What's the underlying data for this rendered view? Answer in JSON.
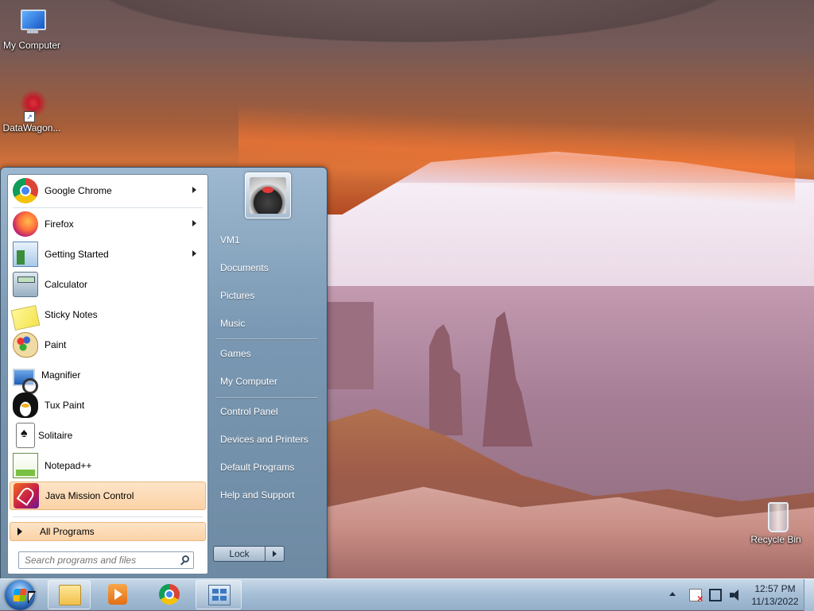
{
  "desktop": {
    "icons": [
      {
        "label": "My Computer",
        "icon": "my-computer-icon"
      },
      {
        "label": "DataWagon...",
        "icon": "datawagon-icon"
      },
      {
        "label": "Recycle Bin",
        "icon": "recycle-bin-icon"
      }
    ]
  },
  "start_menu": {
    "programs": [
      {
        "label": "Google Chrome",
        "icon": "chrome-icon",
        "has_submenu": true
      },
      {
        "label": "Firefox",
        "icon": "firefox-icon",
        "has_submenu": true
      },
      {
        "label": "Getting Started",
        "icon": "getting-started-icon",
        "has_submenu": true
      },
      {
        "label": "Calculator",
        "icon": "calculator-icon",
        "has_submenu": false
      },
      {
        "label": "Sticky Notes",
        "icon": "sticky-notes-icon",
        "has_submenu": false
      },
      {
        "label": "Paint",
        "icon": "paint-icon",
        "has_submenu": false
      },
      {
        "label": "Magnifier",
        "icon": "magnifier-icon",
        "has_submenu": false
      },
      {
        "label": "Tux Paint",
        "icon": "tux-paint-icon",
        "has_submenu": false
      },
      {
        "label": "Solitaire",
        "icon": "solitaire-icon",
        "has_submenu": false
      },
      {
        "label": "Notepad++",
        "icon": "notepad-plus-plus-icon",
        "has_submenu": false
      },
      {
        "label": "Java Mission Control",
        "icon": "java-mission-control-icon",
        "has_submenu": false,
        "highlighted": true
      }
    ],
    "all_programs": "All Programs",
    "search_placeholder": "Search programs and files",
    "right_items": {
      "user": "VM1",
      "documents": "Documents",
      "pictures": "Pictures",
      "music": "Music",
      "games": "Games",
      "my_computer": "My Computer",
      "control_panel": "Control Panel",
      "devices_printers": "Devices and Printers",
      "default_programs": "Default Programs",
      "help_support": "Help and Support"
    },
    "lock_label": "Lock"
  },
  "taskbar": {
    "pinned": [
      {
        "name": "windows-explorer",
        "icon": "folder-icon"
      },
      {
        "name": "windows-media-player",
        "icon": "media-player-icon"
      },
      {
        "name": "google-chrome",
        "icon": "chrome-icon"
      },
      {
        "name": "remote-desktop",
        "icon": "remote-desktop-icon"
      }
    ],
    "clock": {
      "time": "12:57 PM",
      "date": "11/13/2022"
    }
  },
  "colors": {
    "highlight": "#fbd2a6",
    "start_menu_right": "#7a98b3",
    "taskbar": "#a8c0d7"
  }
}
